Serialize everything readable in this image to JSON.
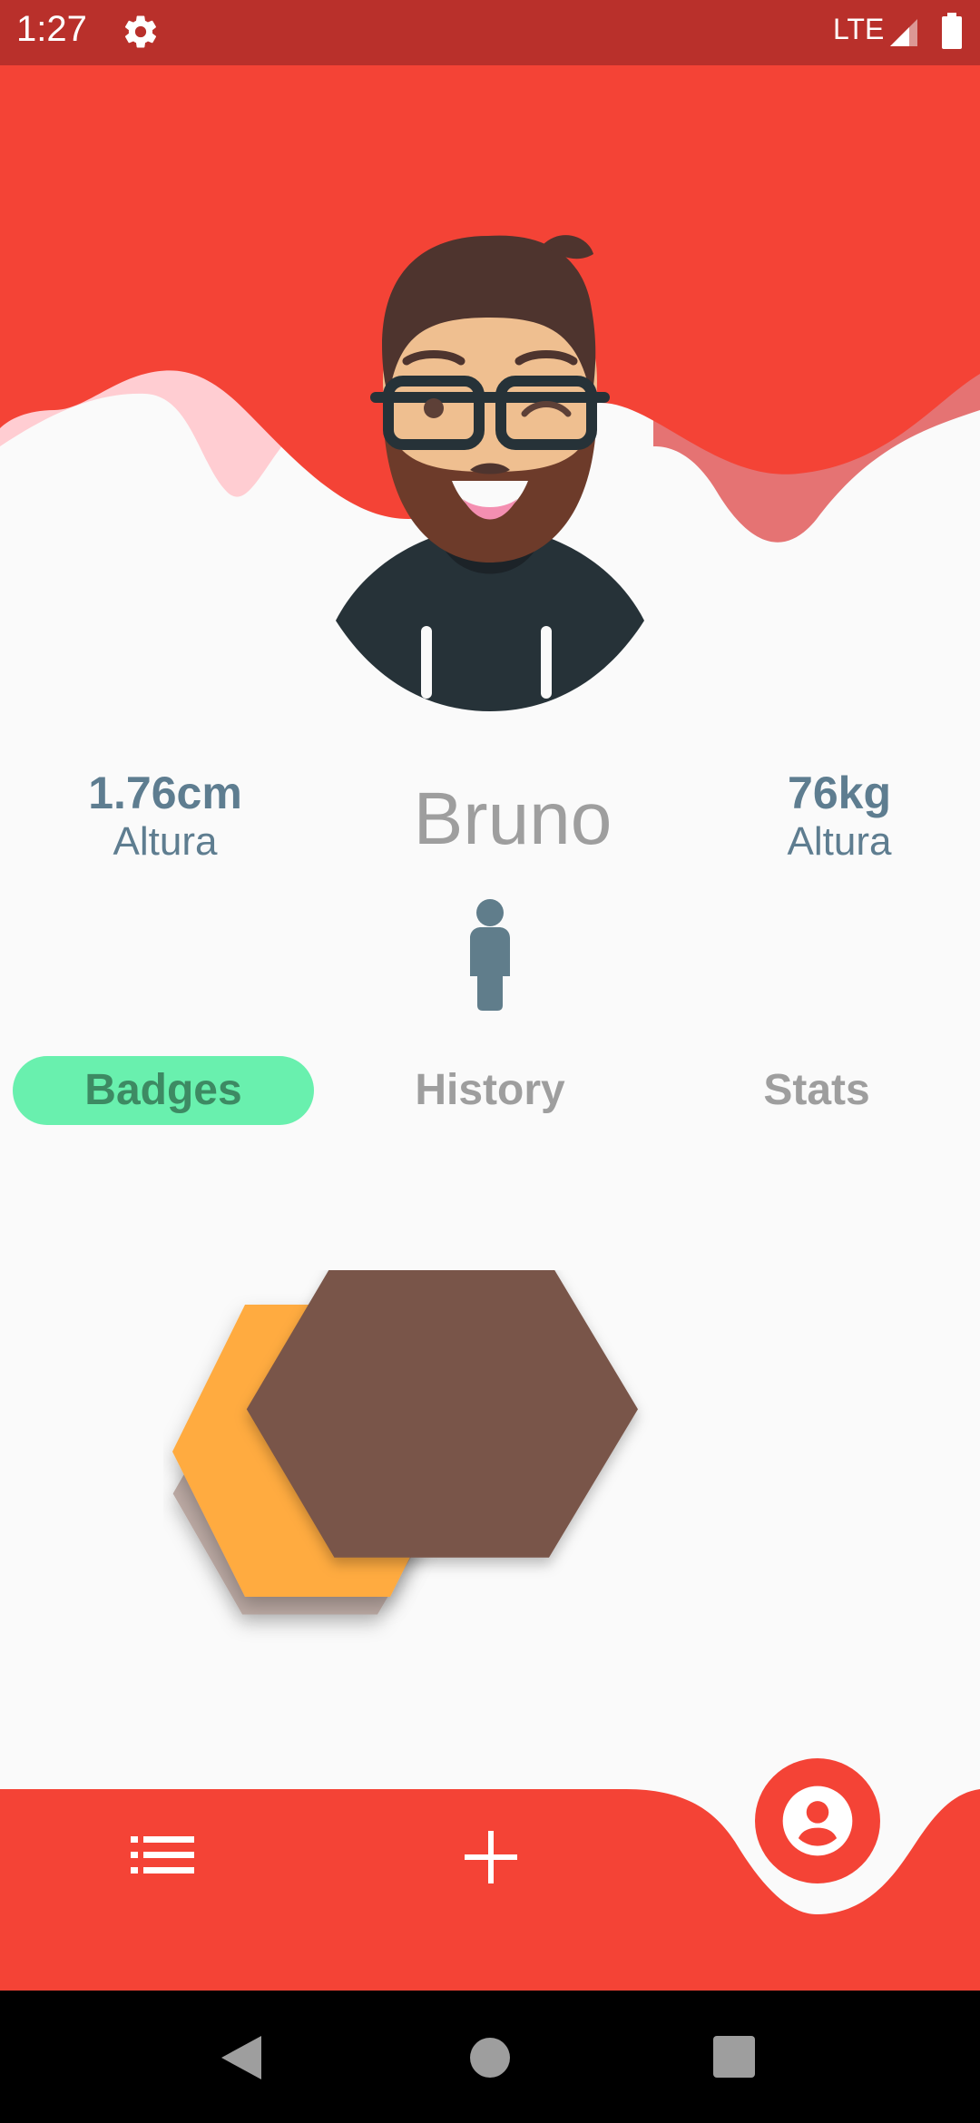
{
  "status_bar": {
    "time": "1:27",
    "network": "LTE",
    "icons": [
      "gear-icon",
      "signal-icon",
      "battery-icon"
    ]
  },
  "profile": {
    "name": "Bruno",
    "height": {
      "value": "1.76cm",
      "label": "Altura"
    },
    "weight": {
      "value": "76kg",
      "label": "Altura"
    }
  },
  "tabs": [
    {
      "label": "Badges",
      "active": true
    },
    {
      "label": "History",
      "active": false
    },
    {
      "label": "Stats",
      "active": false
    }
  ],
  "badges": [
    {
      "color": "#bcaaa4"
    },
    {
      "color": "#ffab40"
    },
    {
      "color": "#795548"
    }
  ],
  "bottom_nav": {
    "items": [
      "list-icon",
      "add-icon",
      "account-icon"
    ]
  },
  "colors": {
    "primary": "#f44336",
    "status_bar": "#b9302b",
    "active_tab": "#69f0ae",
    "stat_text": "#5e7d90"
  }
}
